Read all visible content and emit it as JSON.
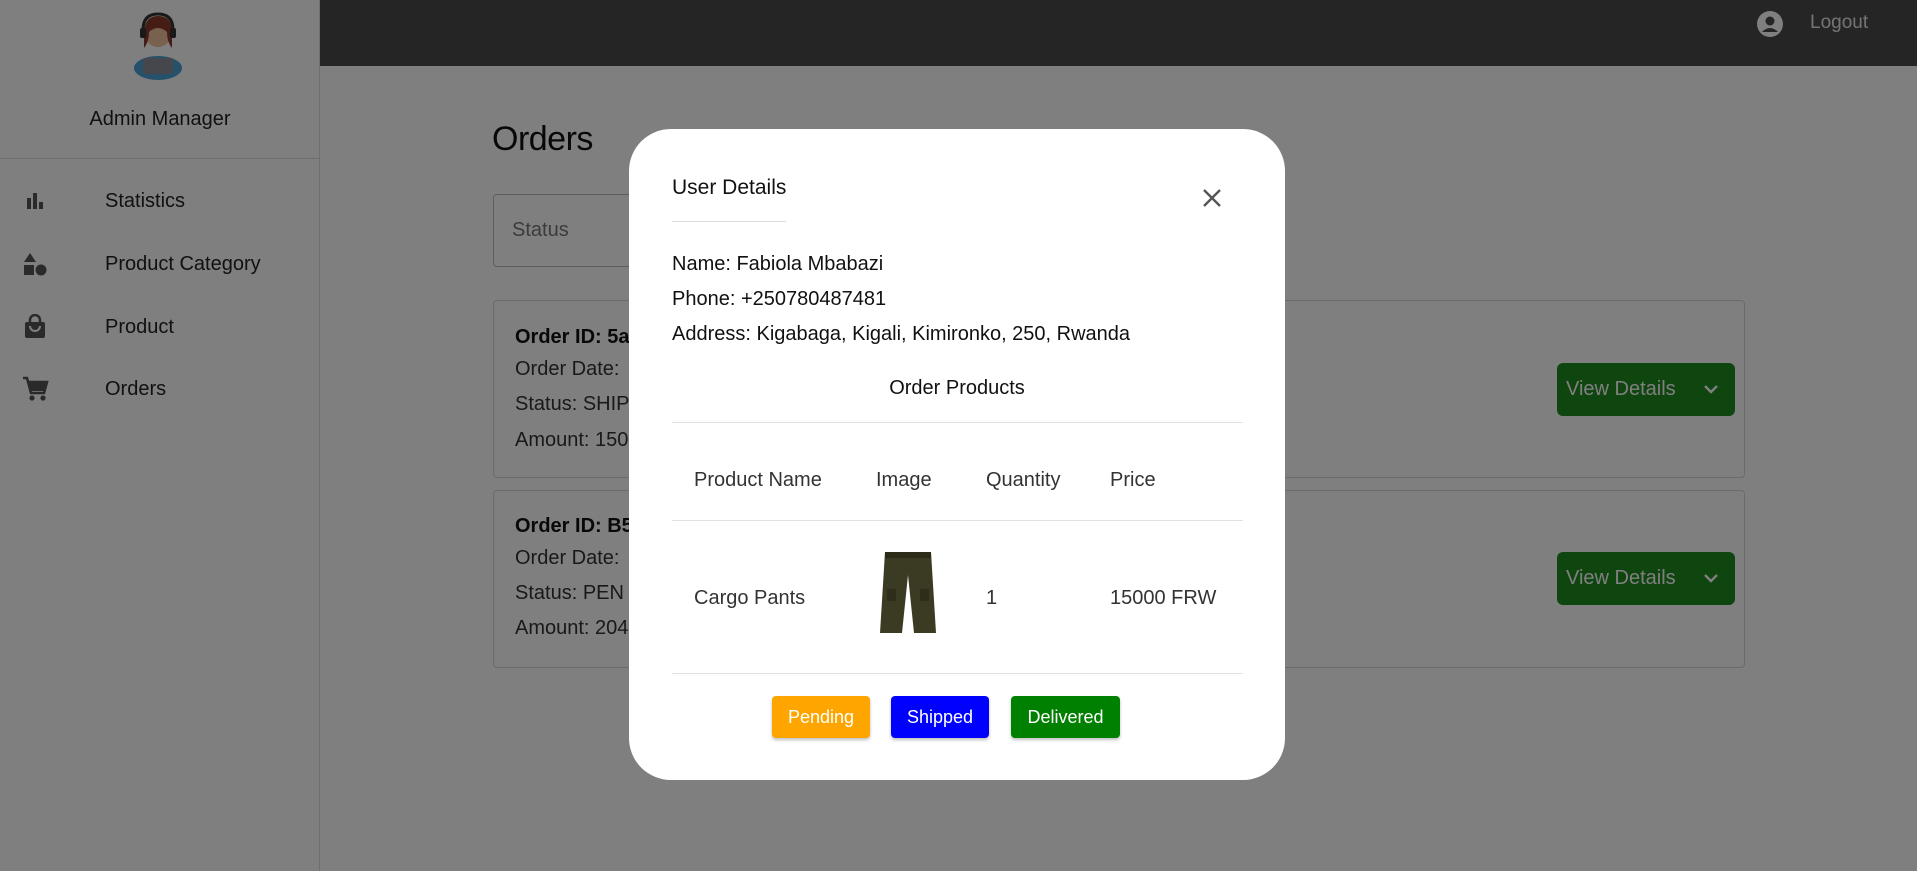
{
  "sidebar": {
    "admin_name": "Admin Manager",
    "items": [
      {
        "label": "Statistics",
        "icon": "bar-chart-icon"
      },
      {
        "label": "Product Category",
        "icon": "shapes-icon"
      },
      {
        "label": "Product",
        "icon": "shopping-bag-icon"
      },
      {
        "label": "Orders",
        "icon": "cart-icon"
      }
    ]
  },
  "topbar": {
    "logout_label": "Logout",
    "account_icon": "account-circle-icon"
  },
  "page": {
    "title": "Orders",
    "status_filter": {
      "label": "Status"
    },
    "orders": [
      {
        "id_prefix": "Order ID: 5aa",
        "date_prefix": "Order Date:",
        "status_prefix": "Status: SHIP",
        "amount_prefix": "Amount: 150",
        "button_label": "View Details"
      },
      {
        "id_prefix": "Order ID: B5",
        "date_prefix": "Order Date:",
        "status_prefix": "Status: PEN",
        "amount_prefix": "Amount: 204",
        "button_label": "View Details"
      }
    ]
  },
  "modal": {
    "title": "User Details",
    "name": "Name: Fabiola Mbabazi",
    "phone": "Phone: +250780487481",
    "address": "Address: Kigabaga, Kigali, Kimironko, 250, Rwanda",
    "section_title": "Order Products",
    "columns": [
      "Product Name",
      "Image",
      "Quantity",
      "Price"
    ],
    "rows": [
      {
        "product_name": "Cargo Pants",
        "quantity": "1",
        "price": "15000 FRW"
      }
    ],
    "status_buttons": [
      {
        "label": "Pending",
        "color": "#ffa500"
      },
      {
        "label": "Shipped",
        "color": "#0000ff"
      },
      {
        "label": "Delivered",
        "color": "#008000"
      }
    ]
  },
  "colors": {
    "topbar": "#4a4a4a",
    "view_button": "#1f8a1f",
    "backdrop": "rgba(0,0,0,0.5)"
  }
}
